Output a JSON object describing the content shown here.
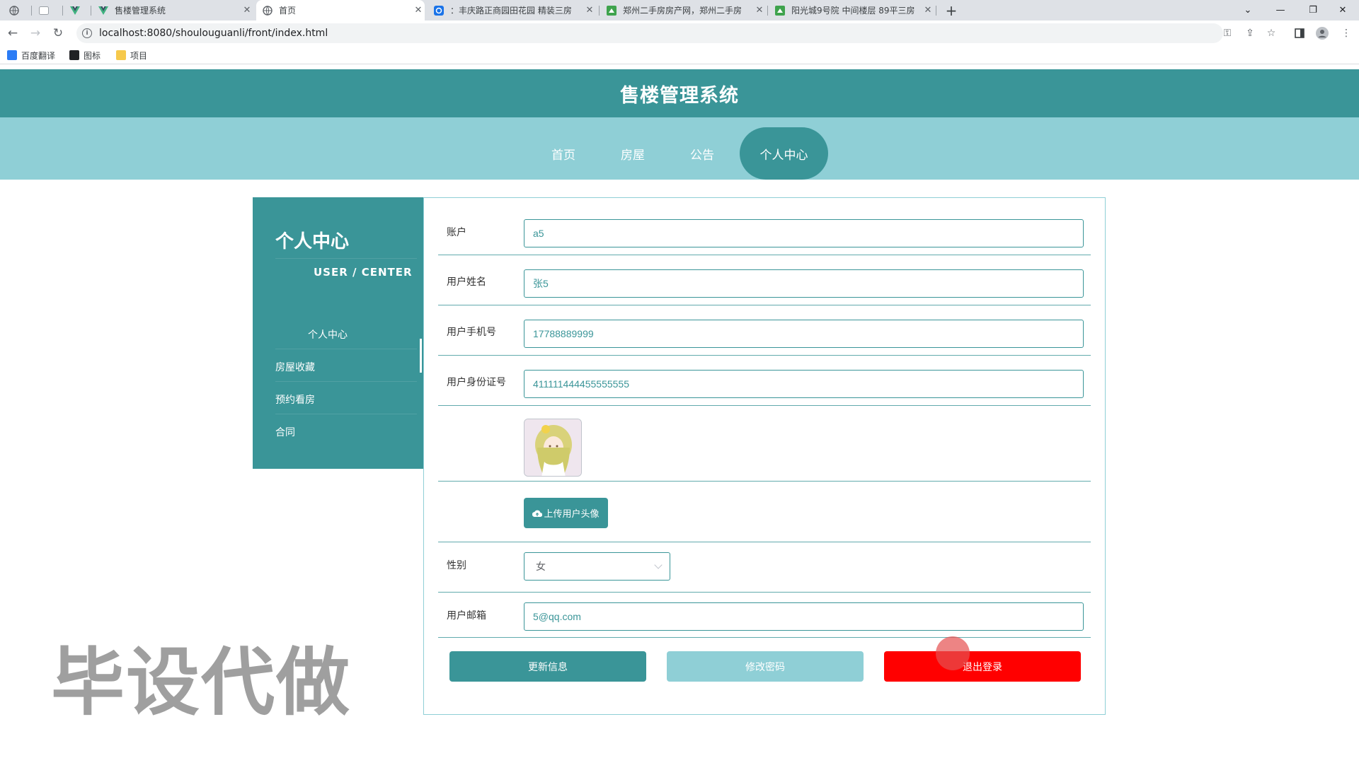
{
  "browser": {
    "tabs": [
      {
        "title": "",
        "icon": "globe-icon"
      },
      {
        "title": "",
        "icon": "blank-page-icon"
      },
      {
        "title": "",
        "icon": "vue-icon"
      },
      {
        "title": "售楼管理系统",
        "icon": "vue-icon"
      },
      {
        "title": "首页",
        "icon": "globe-icon"
      },
      {
        "title": "：丰庆路正商园田花园 精装三房",
        "icon": "anjuke-icon"
      },
      {
        "title": "郑州二手房房产网，郑州二手房",
        "icon": "anjuke-green-icon"
      },
      {
        "title": "阳光城9号院 中间楼层 89平三房",
        "icon": "anjuke-green-icon"
      }
    ],
    "url": "localhost:8080/shoulouguanli/front/index.html",
    "bookmarks": [
      "百度翻译",
      "图标",
      "项目"
    ]
  },
  "header": {
    "title": "售楼管理系统"
  },
  "nav": {
    "items": [
      "首页",
      "房屋",
      "公告",
      "个人中心"
    ],
    "active_index": 3
  },
  "sidebar": {
    "title": "个人中心",
    "subtitle": "USER / CENTER",
    "items": [
      "个人中心",
      "房屋收藏",
      "预约看房",
      "合同"
    ]
  },
  "form": {
    "account_label": "账户",
    "account_value": "a5",
    "name_label": "用户姓名",
    "name_value": "张5",
    "phone_label": "用户手机号",
    "phone_value": "17788889999",
    "idcard_label": "用户身份证号",
    "idcard_value": "411111444455555555",
    "upload_label": "上传用户头像",
    "gender_label": "性别",
    "gender_value": "女",
    "email_label": "用户邮箱",
    "email_value": "5@qq.com"
  },
  "actions": {
    "update": "更新信息",
    "change_password": "修改密码",
    "logout": "退出登录"
  },
  "colors": {
    "primary": "#3a9598",
    "nav_bg": "#8fcfd6",
    "password_btn": "#8fcfd6",
    "logout_btn": "#ff0000"
  },
  "watermark": "毕设代做"
}
